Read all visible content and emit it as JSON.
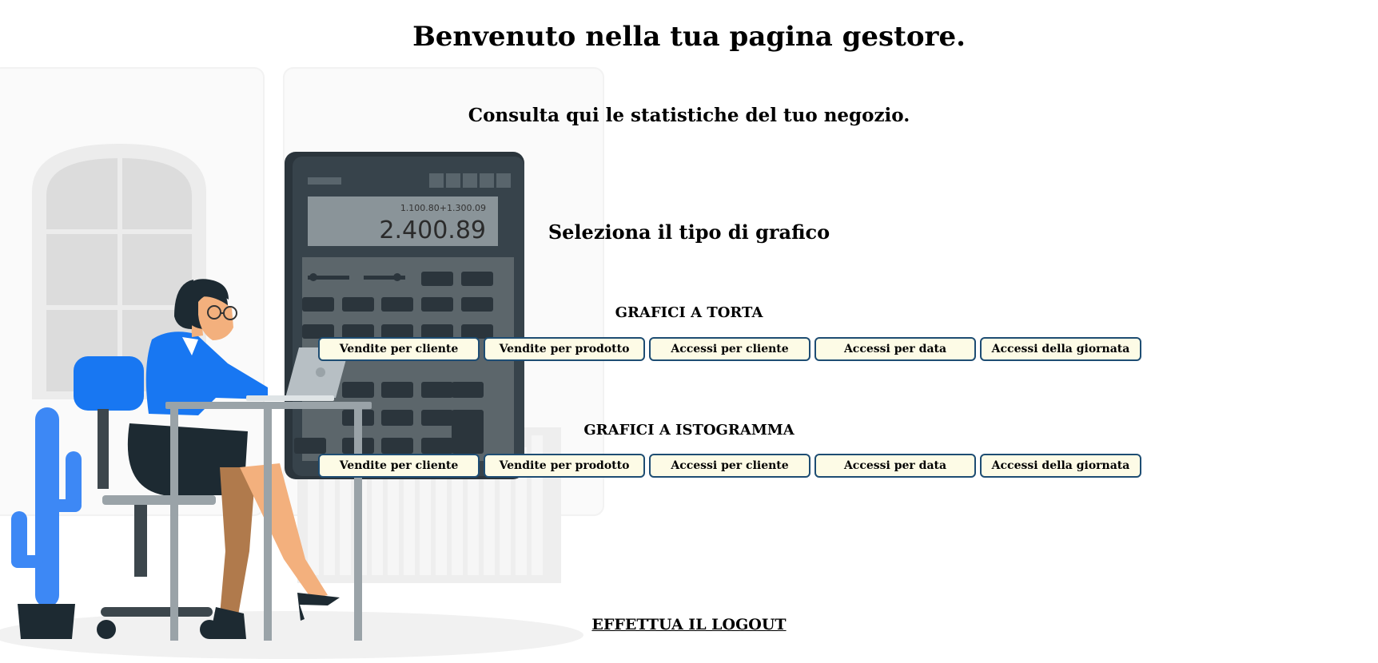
{
  "header": {
    "title": "Benvenuto nella tua pagina gestore.",
    "subtitle": "Consulta qui le statistiche del tuo negozio."
  },
  "select_title": "Seleziona il tipo di grafico",
  "pie_section": {
    "label": "GRAFICI A TORTA",
    "buttons": [
      "Vendite per cliente",
      "Vendite per prodotto",
      "Accessi per cliente",
      "Accessi per data",
      "Accessi della giornata"
    ]
  },
  "histogram_section": {
    "label": "GRAFICI A ISTOGRAMMA",
    "buttons": [
      "Vendite per cliente",
      "Vendite per prodotto",
      "Accessi per cliente",
      "Accessi per data",
      "Accessi della giornata"
    ]
  },
  "illustration": {
    "calc_small": "1.100.80+1.300.09",
    "calc_big": "2.400.89"
  },
  "logout_label": "EFFETTUA IL LOGOUT",
  "colors": {
    "button_bg": "#fdfbe6",
    "button_border": "#1e4d73",
    "accent_blue": "#1877f2"
  }
}
